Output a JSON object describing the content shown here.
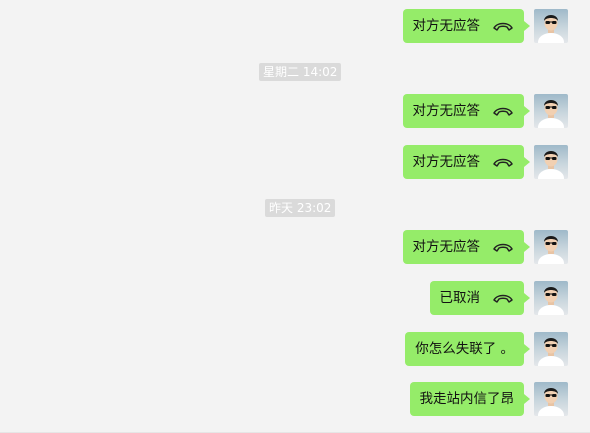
{
  "messages": [
    {
      "type": "call",
      "text": "对方无应答",
      "icon": "phone-hangup-icon"
    },
    {
      "type": "time",
      "text": "星期二 14:02"
    },
    {
      "type": "call",
      "text": "对方无应答",
      "icon": "phone-hangup-icon"
    },
    {
      "type": "call",
      "text": "对方无应答",
      "icon": "phone-hangup-icon"
    },
    {
      "type": "time",
      "text": "昨天 23:02"
    },
    {
      "type": "call",
      "text": "对方无应答",
      "icon": "phone-hangup-icon"
    },
    {
      "type": "call",
      "text": "已取消",
      "icon": "phone-hangup-icon"
    },
    {
      "type": "text",
      "text": "你怎么失联了 。"
    },
    {
      "type": "text",
      "text": "我走站内信了昂"
    }
  ],
  "colors": {
    "bubble": "#95ec69",
    "background": "#f3f3f3",
    "time_pill": "#dadada"
  }
}
